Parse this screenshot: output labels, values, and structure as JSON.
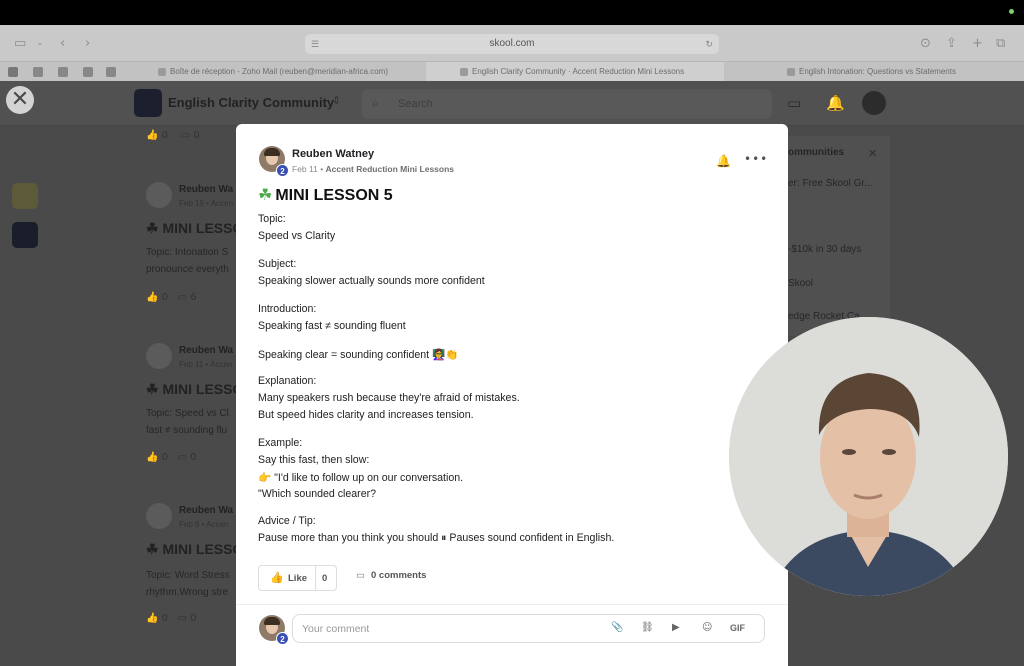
{
  "browser": {
    "url": "skool.com",
    "tabs": [
      "Boîte de réception - Zoho Mail (reuben@meridian-africa.com)",
      "English Clarity Community · Accent Reduction Mini Lessons",
      "English Intonation: Questions vs Statements"
    ]
  },
  "header": {
    "community_name": "English Clarity Community",
    "search_placeholder": "Search"
  },
  "background_feed": {
    "posts": [
      {
        "author": "Reuben Wa",
        "date": "Feb 19 • Accen",
        "title": "MINI LESSO",
        "body": [
          "Topic: Intonation S",
          "pronounce everyth"
        ],
        "likes": "0",
        "comments": "6"
      },
      {
        "author": "Reuben Wa",
        "date": "Feb 11 • Accen",
        "title": "MINI LESSO",
        "body": [
          "Topic: Speed vs Cl",
          "fast ≠ sounding flu"
        ],
        "likes": "0",
        "comments": "0"
      },
      {
        "author": "Reuben Wa",
        "date": "Feb 6 • Accen",
        "title": "MINI LESSO",
        "body": [
          "Topic: Word Stress",
          "rhythm.Wrong stre"
        ],
        "likes": "0",
        "comments": "0"
      }
    ],
    "top_likes": "0",
    "top_comments": "0",
    "right_panel": {
      "title": "ommunities",
      "items": [
        "er: Free Skool Gr...",
        "-$10k in 30 days",
        "Skool",
        "edge Rocket Ca..."
      ]
    }
  },
  "post": {
    "author": "Reuben Watney",
    "level": "2",
    "date": "Feb 11",
    "category": "Accent Reduction Mini Lessons",
    "title": "MINI LESSON 5",
    "lines": {
      "topic_label": "Topic:",
      "topic": "Speed vs Clarity",
      "subject_label": "Subject:",
      "subject": "Speaking slower actually sounds more confident",
      "intro_label": "Introduction:",
      "intro": "Speaking fast ≠ sounding fluent",
      "clear": "Speaking clear = sounding confident 👩‍🏫👏",
      "explanation_label": "Explanation:",
      "explanation_1": "Many speakers rush because they're afraid of mistakes.",
      "explanation_2": "But speed hides clarity and increases tension.",
      "example_label": "Example:",
      "example_1": "Say this fast, then slow:",
      "example_2": "👉 \"I'd like to follow up on our conversation.",
      "example_3": "\"Which sounded clearer?",
      "advice_label": "Advice / Tip:",
      "advice": "Pause more than you think you should ⏸ Pauses sound confident in English."
    },
    "like_label": "Like",
    "like_count": "0",
    "comments_label": "0 comments",
    "comment_placeholder": "Your comment",
    "gif_label": "GIF"
  }
}
